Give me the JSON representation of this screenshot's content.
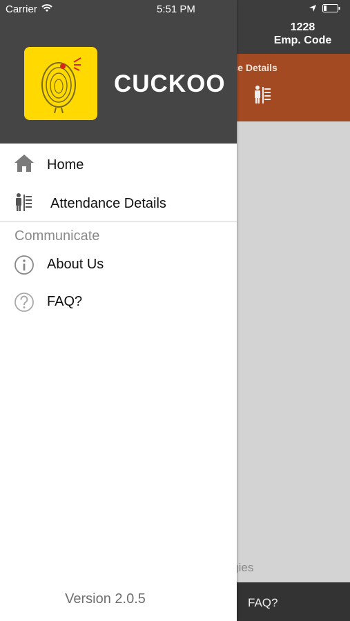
{
  "status_bar": {
    "carrier": "Carrier",
    "time": "5:51 PM"
  },
  "drawer": {
    "app_name": "CUCKOO",
    "menu": [
      {
        "label": "Home",
        "icon": "home-icon"
      },
      {
        "label": "Attendance Details",
        "icon": "attendance-icon"
      }
    ],
    "section_title": "Communicate",
    "section_items": [
      {
        "label": "About Us",
        "icon": "info-icon"
      },
      {
        "label": "FAQ?",
        "icon": "question-icon"
      }
    ],
    "version": "Version 2.0.5"
  },
  "background": {
    "emp_code_value": "1228",
    "emp_code_label": "Emp. Code",
    "card_title": "ndance Details",
    "company_partial": "nologies",
    "footer_faq": "FAQ?"
  },
  "colors": {
    "logo_bg": "#ffd900",
    "header_bg": "#454545",
    "card_bg": "#a34a23"
  }
}
